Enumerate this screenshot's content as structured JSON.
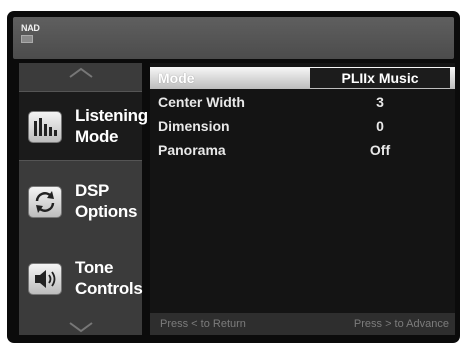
{
  "brand": "NAD",
  "sidebar": {
    "items": [
      {
        "icon": "bar-graph-icon",
        "label_line1": "Listening",
        "label_line2": "Mode",
        "active": true
      },
      {
        "icon": "refresh-arrows-icon",
        "label_line1": "DSP",
        "label_line2": "Options",
        "active": false
      },
      {
        "icon": "speaker-icon",
        "label_line1": "Tone",
        "label_line2": "Controls",
        "active": false
      }
    ]
  },
  "settings": {
    "rows": [
      {
        "label": "Mode",
        "value": "PLIIx Music",
        "selected": true
      },
      {
        "label": "Center Width",
        "value": "3",
        "selected": false
      },
      {
        "label": "Dimension",
        "value": "0",
        "selected": false
      },
      {
        "label": "Panorama",
        "value": "Off",
        "selected": false
      }
    ]
  },
  "footer": {
    "left_hint": "Press < to Return",
    "right_hint": "Press > to Advance"
  }
}
